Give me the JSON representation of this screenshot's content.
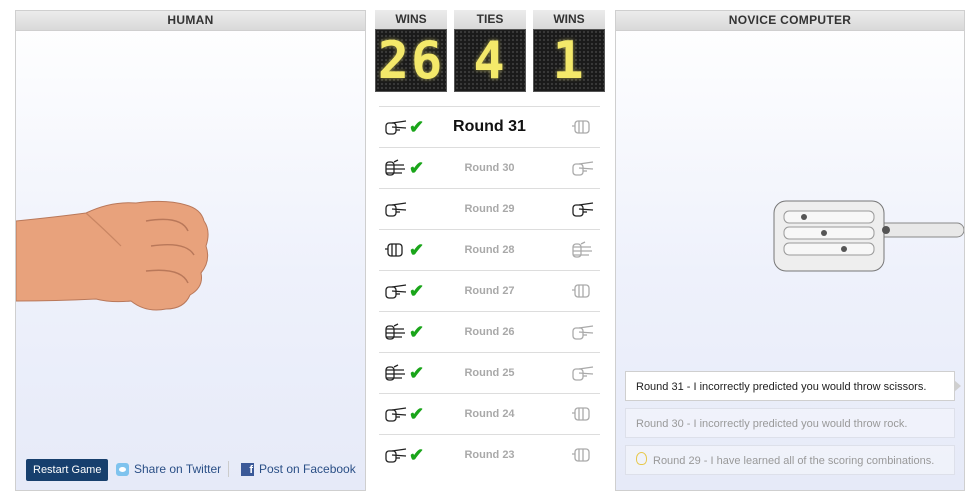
{
  "human_panel": {
    "title": "HUMAN"
  },
  "computer_panel": {
    "title": "NOVICE COMPUTER"
  },
  "scoreboard": {
    "human_wins": {
      "label": "WINS",
      "value": "26"
    },
    "ties": {
      "label": "TIES",
      "value": "4"
    },
    "computer_wins": {
      "label": "WINS",
      "value": "1"
    }
  },
  "rounds": [
    {
      "label": "Round 31",
      "left": "scissors",
      "right": "rock",
      "check": true
    },
    {
      "label": "Round 30",
      "left": "paper",
      "right": "scissors",
      "check": true
    },
    {
      "label": "Round 29",
      "left": "scissors",
      "right": "scissors",
      "check": false
    },
    {
      "label": "Round 28",
      "left": "rock",
      "right": "paper",
      "check": true
    },
    {
      "label": "Round 27",
      "left": "scissors",
      "right": "rock",
      "check": true
    },
    {
      "label": "Round 26",
      "left": "paper",
      "right": "scissors",
      "check": true
    },
    {
      "label": "Round 25",
      "left": "paper",
      "right": "scissors",
      "check": true
    },
    {
      "label": "Round 24",
      "left": "scissors",
      "right": "rock",
      "check": true
    },
    {
      "label": "Round 23",
      "left": "scissors",
      "right": "rock",
      "check": true
    }
  ],
  "actions": {
    "restart_label": "Restart Game",
    "twitter_label": "Share on Twitter",
    "facebook_label": "Post on Facebook"
  },
  "messages": [
    {
      "text": "Round 31 - I incorrectly predicted you would throw scissors.",
      "icon": ""
    },
    {
      "text": "Round 30 - I incorrectly predicted you would throw rock.",
      "icon": ""
    },
    {
      "text": "Round 29 - I have learned all of the scoring combinations.",
      "icon": "lightbulb-icon"
    }
  ],
  "colors": {
    "accent": "#173f6d",
    "check": "#1aa51a",
    "digits": "#f4e96a"
  },
  "check_glyph": "✔"
}
